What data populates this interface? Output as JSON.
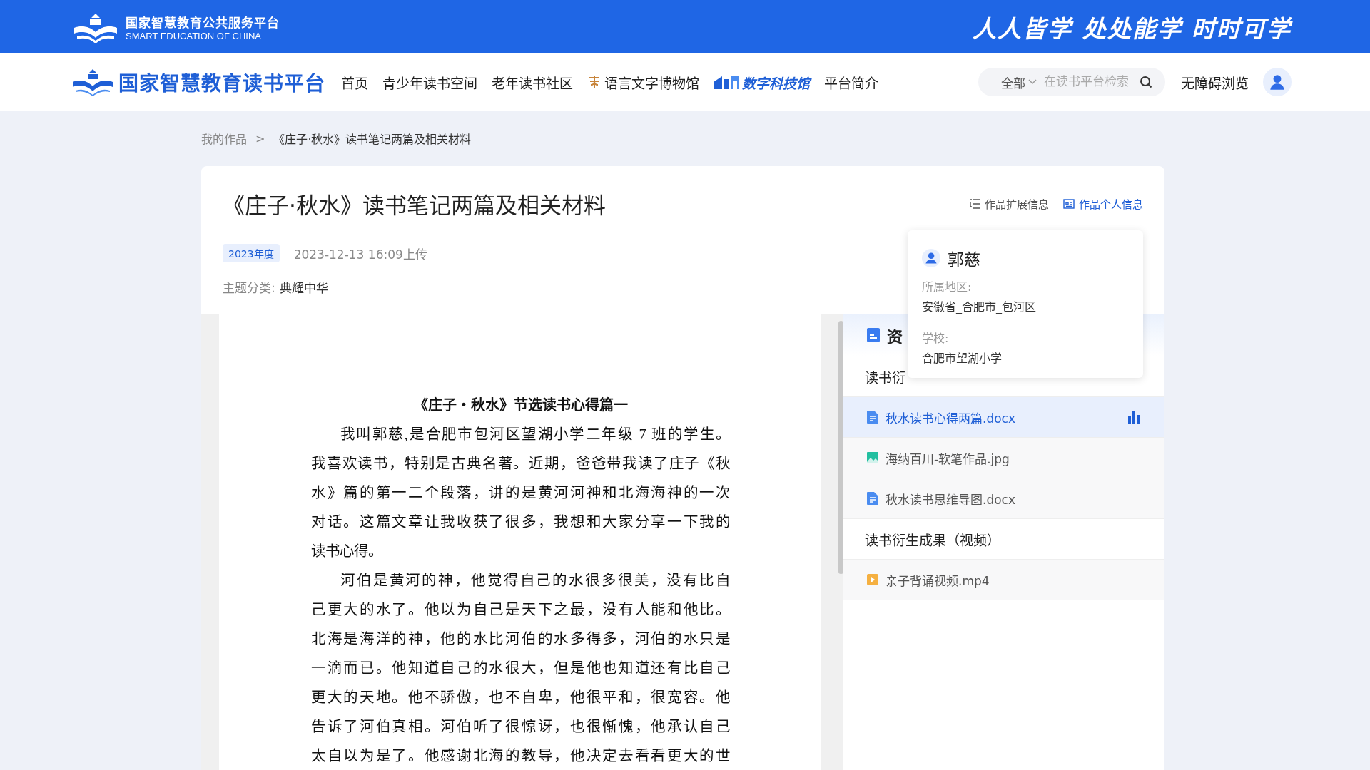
{
  "top_bar": {
    "platform_name": "国家智慧教育公共服务平台",
    "platform_name_en": "SMART EDUCATION OF CHINA",
    "slogan": "人人皆学 处处能学 时时可学"
  },
  "nav": {
    "site_title": "国家智慧教育读书平台",
    "items": [
      {
        "label": "首页",
        "kind": "plain"
      },
      {
        "label": "青少年读书空间",
        "kind": "plain"
      },
      {
        "label": "老年读书社区",
        "kind": "plain"
      },
      {
        "label": "语言文字博物馆",
        "kind": "museum"
      },
      {
        "label": "数字科技馆",
        "kind": "science"
      },
      {
        "label": "平台简介",
        "kind": "plain"
      }
    ],
    "search": {
      "scope": "全部",
      "placeholder": "在读书平台检索"
    },
    "accessibility": "无障碍浏览"
  },
  "breadcrumb": [
    "我的作品",
    "《庄子·秋水》读书笔记两篇及相关材料"
  ],
  "breadcrumb_separator": ">",
  "work": {
    "title": "《庄子·秋水》读书笔记两篇及相关材料",
    "year_tag": "2023年度",
    "uploaded": "2023-12-13 16:09上传",
    "category_label": "主题分类:",
    "category": "典耀中华",
    "actions": [
      {
        "label": "作品扩展信息",
        "selected": false
      },
      {
        "label": "作品个人信息",
        "selected": true
      }
    ]
  },
  "author_popup": {
    "name": "郭慈",
    "fields": [
      {
        "label": "所属地区:",
        "value": "安徽省_合肥市_包河区"
      },
      {
        "label": "学校:",
        "value": "合肥市望湖小学"
      }
    ]
  },
  "document": {
    "heading": "《庄子・秋水》节选读书心得篇一",
    "paragraphs": [
      [
        "我叫郭慈,是合肥市包河区望湖小学二年级 7 班的学生。",
        "我喜欢读书，特别是古典名著。近期，爸爸带我读了庄子《秋",
        "水》篇的第一二个段落，讲的是黄河河神和北海海神的一次",
        "对话。这篇文章让我收获了很多，我想和大家分享一下我的",
        "读书心得。"
      ],
      [
        "河伯是黄河的神，他觉得自己的水很多很美，没有比自",
        "己更大的水了。他以为自己是天下之最，没有人能和他比。",
        "北海是海洋的神，他的水比河伯的水多得多，河伯的水只是",
        "一滴而已。他知道自己的水很大，但是他也知道还有比自己",
        "更大的天地。他不骄傲，也不自卑，他很平和，很宽容。他",
        "告诉了河伯真相。河伯听了很惊讶，也很惭愧，他承认自己",
        "太自以为是了。他感谢北海的教导，他决定去看看更大的世"
      ]
    ]
  },
  "resources": {
    "header": "资",
    "sections": [
      {
        "title": "读书衍",
        "files": [
          {
            "name": "秋水读书心得两篇.docx",
            "kind": "doc",
            "selected": true
          },
          {
            "name": "海纳百川-软笔作品.jpg",
            "kind": "image",
            "selected": false
          },
          {
            "name": "秋水读书思维导图.docx",
            "kind": "doc",
            "selected": false
          }
        ]
      },
      {
        "title": "读书衍生成果（视频）",
        "files": [
          {
            "name": "亲子背诵视频.mp4",
            "kind": "video",
            "selected": false
          }
        ]
      }
    ]
  }
}
